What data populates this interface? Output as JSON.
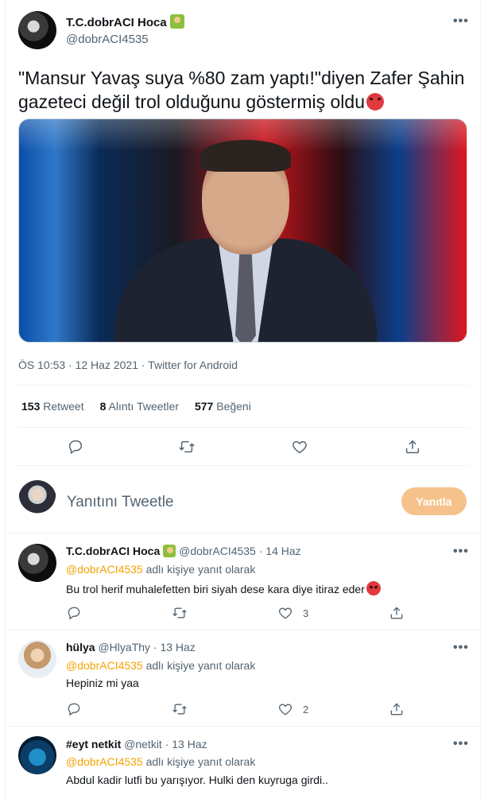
{
  "main_tweet": {
    "display_name": "T.C.dobrACI Hoca",
    "handle": "@dobrACI4535",
    "text_line1": "\"Mansur Yavaş suya %80 zam yaptı!\"diyen Zafer Şahin",
    "text_line2": "gazeteci değil trol olduğunu göstermiş oldu",
    "timestamp": "ÖS 10:53 · 12 Haz 2021 · Twitter for Android",
    "stats": {
      "retweet_count": "153",
      "retweet_label": "Retweet",
      "quote_count": "8",
      "quote_label": "Alıntı Tweetler",
      "like_count": "577",
      "like_label": "Beğeni"
    }
  },
  "composer": {
    "placeholder": "Yanıtını Tweetle",
    "button_label": "Yanıtla"
  },
  "replies": [
    {
      "display_name": "T.C.dobrACI Hoca",
      "handle": "@dobrACI4535",
      "time": "· 14 Haz",
      "replying_to": "@dobrACI4535",
      "replying_suffix": "adlı kişiye yanıt olarak",
      "text": "Bu trol herif muhalefetten biri siyah dese kara diye itiraz eder",
      "like_count": "3"
    },
    {
      "display_name": "hülya",
      "handle": "@HlyaThy",
      "time": "· 13 Haz",
      "replying_to": "@dobrACI4535",
      "replying_suffix": "adlı kişiye yanıt olarak",
      "text": "Hepiniz mi yaa",
      "like_count": "2"
    },
    {
      "display_name": "#eyt netkit",
      "handle": "@netkit",
      "time": "· 13 Haz",
      "replying_to": "@dobrACI4535",
      "replying_suffix": "adlı kişiye yanıt olarak",
      "text": "Abdul kadir lutfi bu yarışıyor.  Hulki den kuyruga girdi..",
      "like_count": ""
    }
  ],
  "more_glyph": "•••",
  "icons": [
    "reply-icon",
    "retweet-icon",
    "like-icon",
    "share-icon",
    "more-icon",
    "angry-face-emoji",
    "teacher-emoji"
  ],
  "colors": {
    "accent": "#f4a300",
    "reply_button": "#f6c28b",
    "muted": "#536471"
  }
}
